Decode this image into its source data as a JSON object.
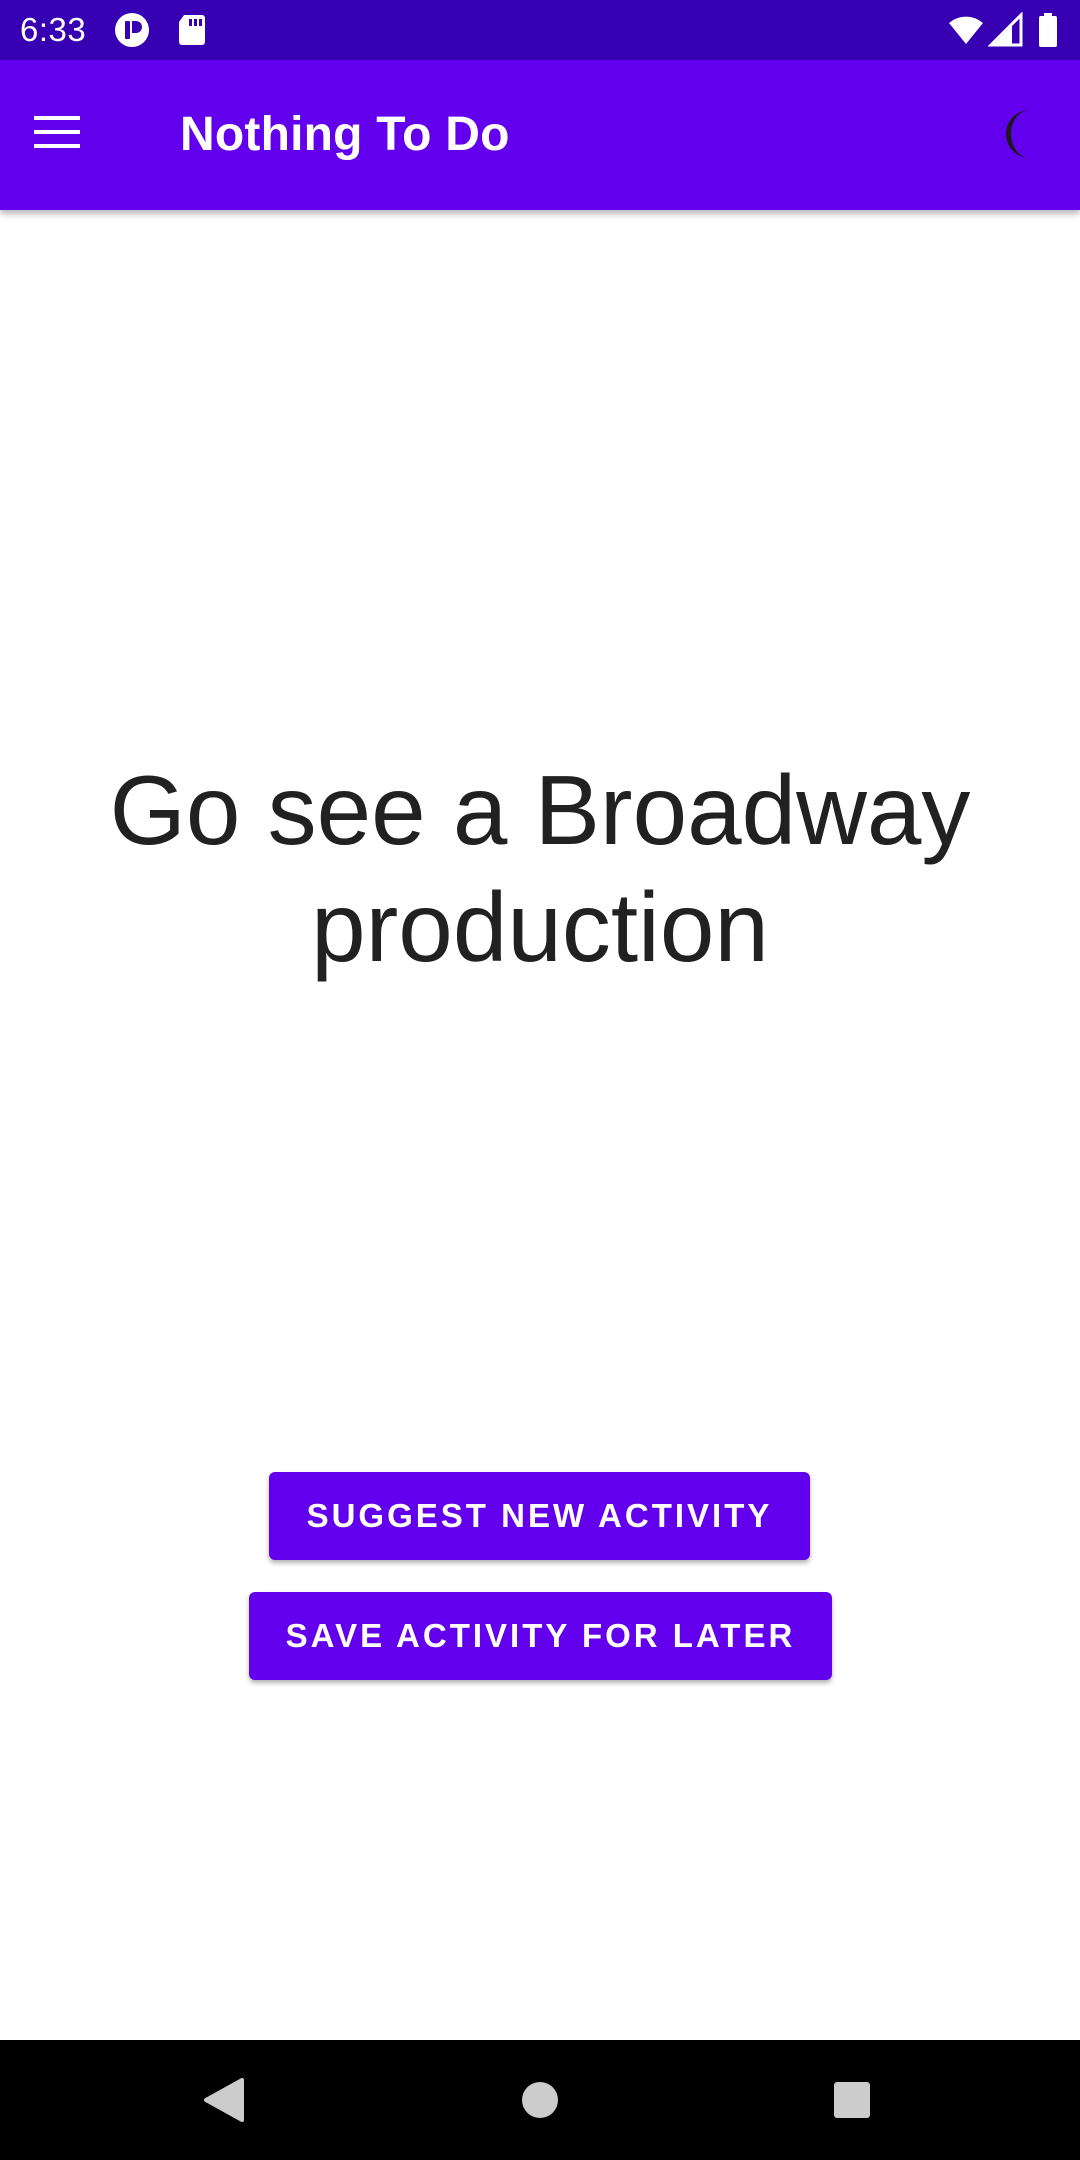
{
  "status_bar": {
    "time": "6:33",
    "icons": [
      "notification-icon",
      "sd-card-icon",
      "wifi-icon",
      "cell-signal-icon",
      "battery-icon"
    ]
  },
  "app_bar": {
    "title": "Nothing To Do",
    "menu_icon": "hamburger-menu-icon",
    "theme_icon": "dark-mode-moon-icon"
  },
  "main": {
    "activity": "Go see a Broadway production"
  },
  "actions": {
    "suggest_label": "SUGGEST NEW ACTIVITY",
    "save_label": "SAVE ACTIVITY FOR LATER"
  },
  "nav_bar": {
    "icons": [
      "back-icon",
      "home-icon",
      "recents-icon"
    ]
  },
  "colors": {
    "status_bar": "#3700b3",
    "primary": "#6200ee",
    "on_primary": "#ffffff",
    "text": "#212121",
    "nav_bar": "#000000"
  }
}
